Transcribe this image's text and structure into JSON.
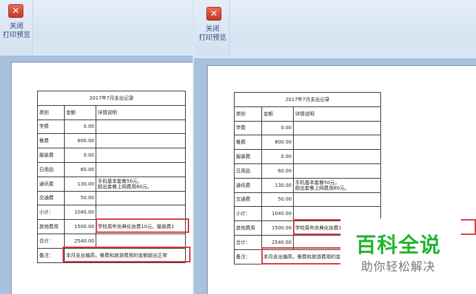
{
  "ribbon": {
    "close_icon_glyph": "✕",
    "close_label_line1": "关闭",
    "close_label_line2": "打印预览"
  },
  "table": {
    "title": "2017年7月支出记录",
    "headers": [
      "类别",
      "金额",
      "详情说明"
    ],
    "rows": [
      {
        "category": "学费",
        "amount": "0.00",
        "detail": ""
      },
      {
        "category": "餐费",
        "amount": "800.00",
        "detail": ""
      },
      {
        "category": "服装费",
        "amount": "0.00",
        "detail": ""
      },
      {
        "category": "日用品",
        "amount": "60.00",
        "detail": ""
      },
      {
        "category": "通讯费",
        "amount": "130.00",
        "detail": "手机基本套餐50元，",
        "detail2": "超出套餐上网费用80元。"
      },
      {
        "category": "交通费",
        "amount": "50.00",
        "detail": ""
      },
      {
        "category": "小计：",
        "amount": "1040.00",
        "detail": ""
      },
      {
        "category": "其他费用",
        "amount": "1500.00",
        "detail": "学校周年庆典化妆费10元、服装费1"
      },
      {
        "category": "合计：",
        "amount": "2540.00",
        "detail": ""
      }
    ],
    "note_label": "备注：",
    "note": "本月支出偏高，餐费和旅游费用的金额超出正常"
  },
  "watermark": {
    "title": "百科全说",
    "subtitle": "助你轻松解决"
  },
  "colors": {
    "highlight": "#d9363e",
    "watermark_green": "#1fb52c"
  }
}
